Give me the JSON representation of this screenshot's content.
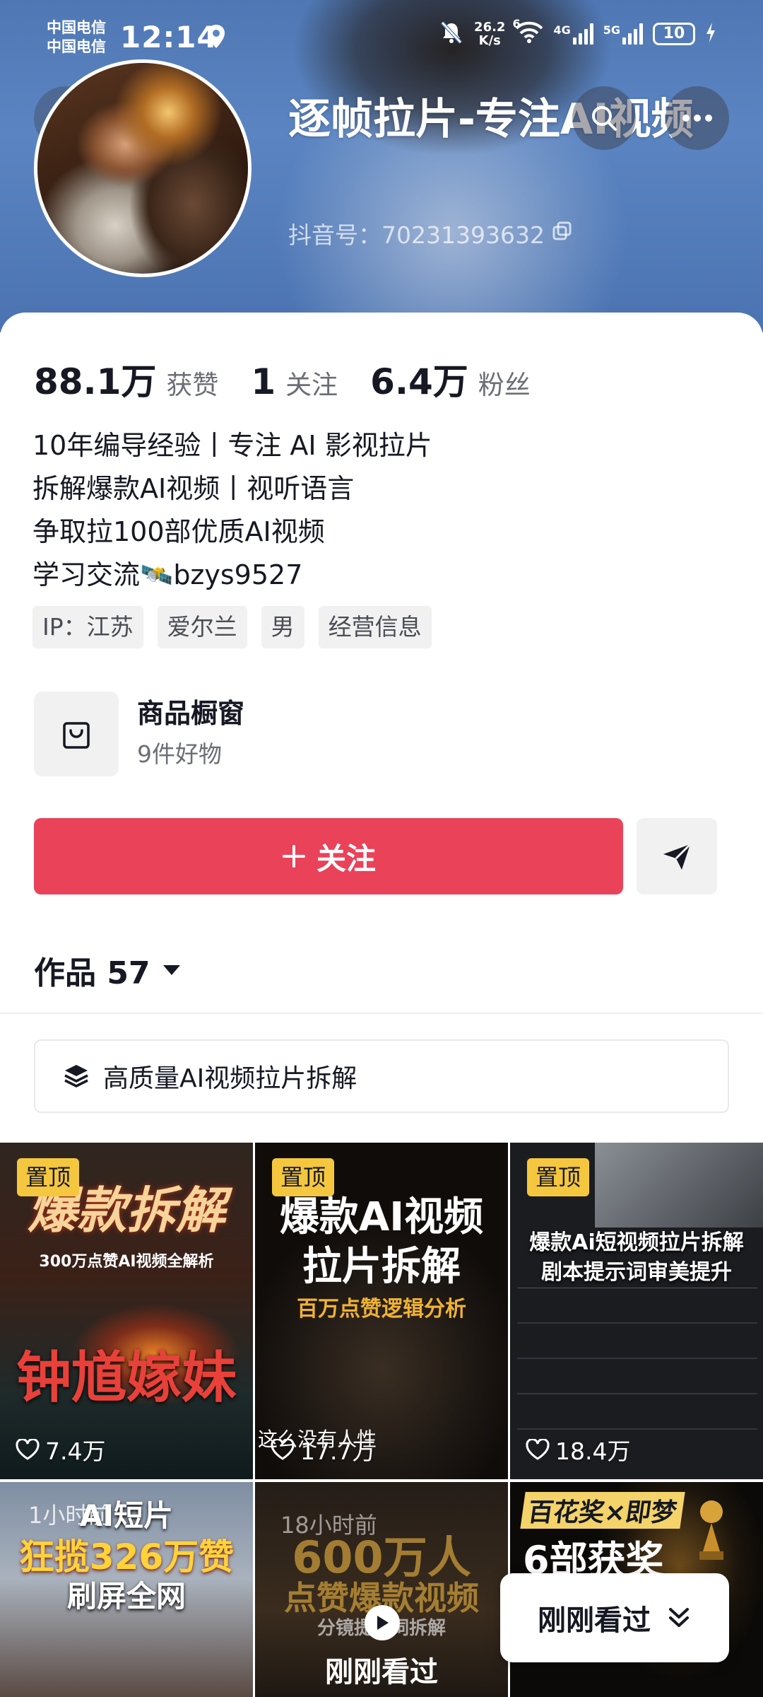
{
  "status_bar": {
    "carrier1": "中国电信",
    "carrier2": "中国电信",
    "time": "12:14",
    "net_speed_value": "26.2",
    "net_speed_unit": "K/s",
    "wifi_num": "6",
    "net_4g": "4G",
    "net_5g": "5G",
    "battery": "10"
  },
  "profile": {
    "name": "逐帧拉片-专注AI视频",
    "douyin_id": "抖音号：70231393632"
  },
  "stats": {
    "likes_num": "88.1万",
    "likes_label": "获赞",
    "following_num": "1",
    "following_label": "关注",
    "fans_num": "6.4万",
    "fans_label": "粉丝"
  },
  "bio": {
    "line1": "10年编导经验丨专注 AI 影视拉片",
    "line2": "拆解爆款AI视频丨视听语言",
    "line3": "争取拉100部优质AI视频",
    "line4": "学习交流🛰️bzys9527"
  },
  "tags": [
    "IP：江苏",
    "爱尔兰",
    "男",
    "经营信息"
  ],
  "shop": {
    "title": "商品橱窗",
    "subtitle": "9件好物"
  },
  "actions": {
    "follow_label": "关注"
  },
  "works": {
    "label": "作品 57"
  },
  "collection": {
    "label": "高质量AI视频拉片拆解"
  },
  "videos": [
    {
      "pinned": "置顶",
      "likes": "7.4万",
      "title_top": "爆款拆解",
      "title_sub": "300万点赞AI视频全解析",
      "title_bottom": "钟馗嫁妹"
    },
    {
      "pinned": "置顶",
      "likes": "17.7万",
      "title_top": "爆款AI视频",
      "title_mid": "拉片拆解",
      "title_sub": "百万点赞逻辑分析",
      "caption": "这么没有人性"
    },
    {
      "pinned": "置顶",
      "likes": "18.4万",
      "title_top": "爆款Ai短视频拉片拆解",
      "title_sub": "剧本提示词审美提升"
    },
    {
      "time": "1小时前",
      "title_top": "AI短片",
      "title_mid": "狂揽326万赞",
      "title_sub": "刷屏全网"
    },
    {
      "time": "18小时前",
      "title_top": "600万人",
      "title_mid": "点赞爆款视频",
      "title_sub": "分镜提示词拆解",
      "bottom_label": "刚刚看过"
    },
    {
      "title_top": "百花奖×即梦",
      "title_mid": "6部获奖"
    }
  ],
  "recent_button": {
    "label": "刚刚看过"
  },
  "colors": {
    "primary": "#ea4259",
    "pin": "#f4c73e",
    "banner": "#5b85c2"
  }
}
